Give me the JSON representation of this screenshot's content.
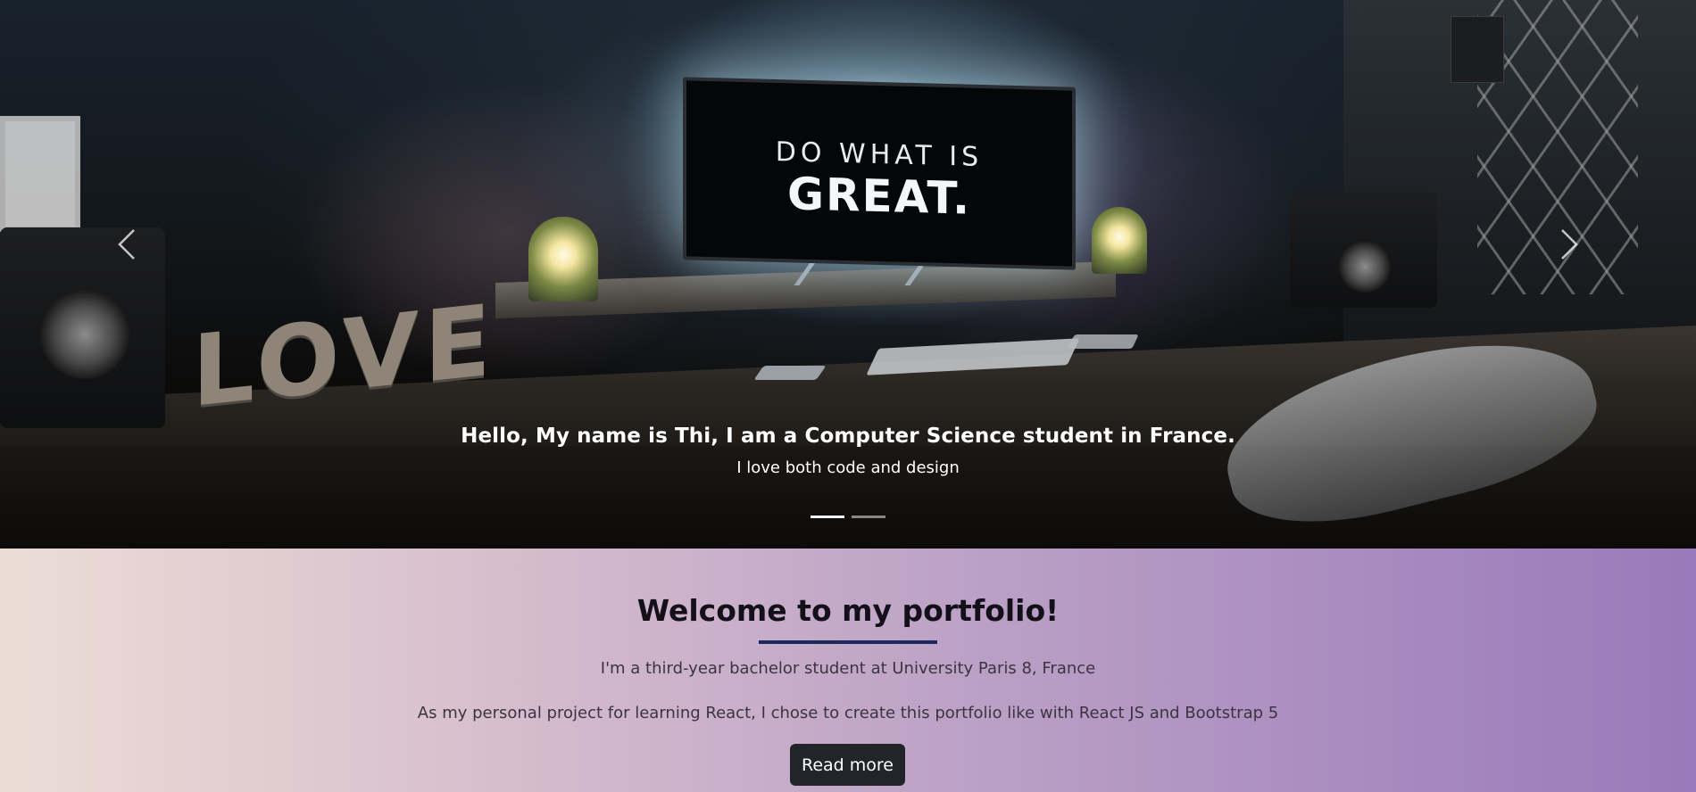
{
  "hero": {
    "monitor_text_line1": "DO WHAT IS",
    "monitor_text_line2": "GREAT.",
    "desk_letters": "LOVE",
    "caption_title": "Hello, My name is Thi, I am a Computer Science student in France.",
    "caption_subtitle": "I love both code and design",
    "prev_icon": "chevron-left-icon",
    "next_icon": "chevron-right-icon",
    "slide_count": 2,
    "active_slide": 1
  },
  "welcome": {
    "title": "Welcome to my portfolio!",
    "line1": "I'm a third-year bachelor student at University Paris 8, France",
    "line2": "As my personal project for learning React, I chose to create this portfolio like with React JS and Bootstrap 5",
    "button_label": "Read more"
  },
  "colors": {
    "underline": "#1b2a5a",
    "button_bg": "#212529",
    "gradient_start": "#ecddd6",
    "gradient_end": "#9a79ba"
  }
}
